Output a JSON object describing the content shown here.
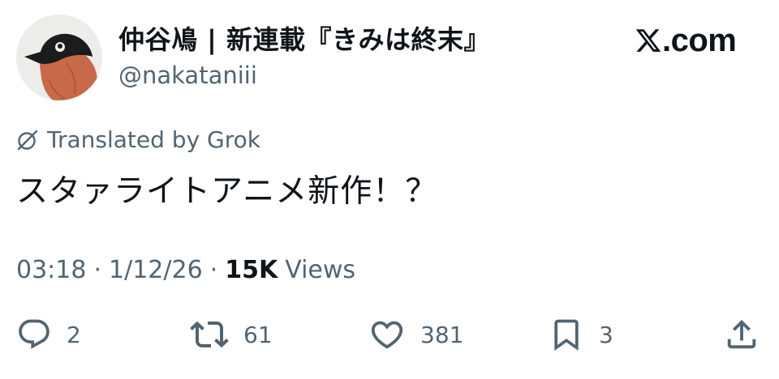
{
  "author": {
    "name": "仲谷鳰 | 新連載『きみは終末』",
    "handle": "@nakataniii"
  },
  "brand": {
    "text": ".com",
    "icon": "x-logo-icon"
  },
  "translation": {
    "label": "Translated by Grok",
    "icon": "grok-icon"
  },
  "tweet": {
    "text": "スタァライトアニメ新作！？"
  },
  "meta": {
    "time": "03:18",
    "separator": "·",
    "date": "1/12/26",
    "views_count": "15K",
    "views_label": "Views"
  },
  "actions": {
    "replies": "2",
    "reposts": "61",
    "likes": "381",
    "bookmarks": "3"
  },
  "colors": {
    "text": "#0f1419",
    "secondary": "#536471",
    "background": "#ffffff",
    "avatar_bird_body": "#c8694a",
    "avatar_bird_head": "#1c1c1c"
  }
}
